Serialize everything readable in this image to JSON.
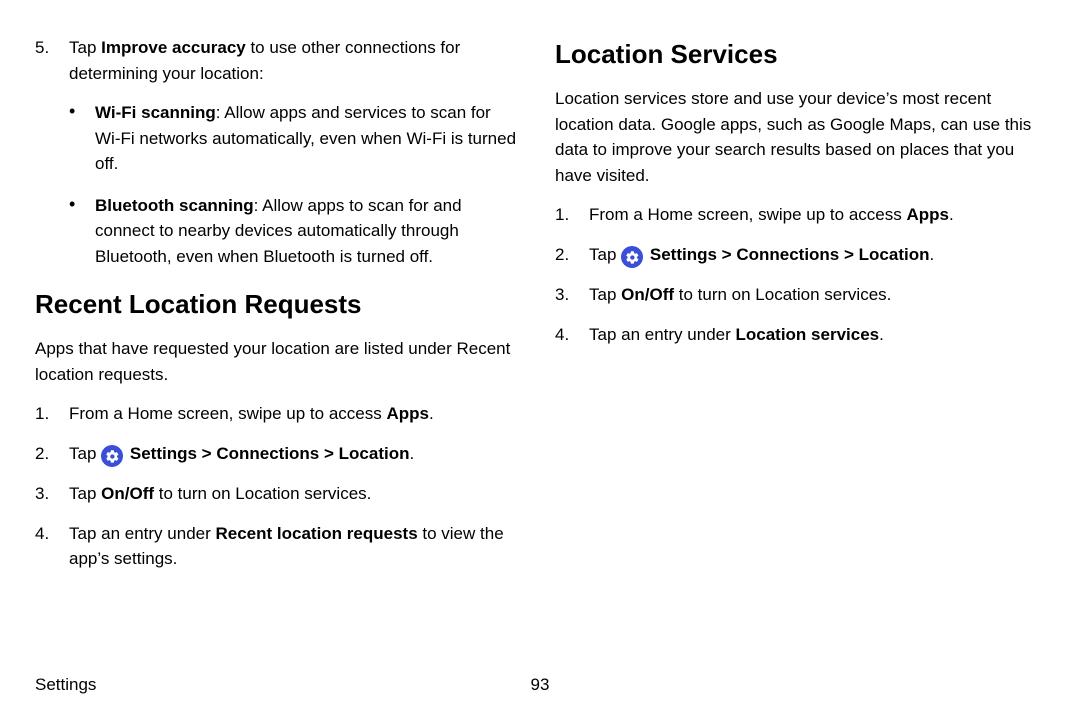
{
  "left": {
    "item5": {
      "num": "5.",
      "pre": "Tap ",
      "bold": "Improve accuracy",
      "post": " to use other connections for determining your location:"
    },
    "wifi": {
      "bold": "Wi‑Fi scanning",
      "post": ": Allow apps and services to scan for Wi‑Fi networks automatically, even when Wi‑Fi is turned off."
    },
    "bt": {
      "bold": "Bluetooth scanning",
      "post": ": Allow apps to scan for and connect to nearby devices automatically through Bluetooth, even when Bluetooth is turned off."
    },
    "h2": "Recent Location Requests",
    "para": "Apps that have requested your location are listed under Recent location requests.",
    "s1": {
      "num": "1.",
      "pre": "From a Home screen, swipe up to access ",
      "bold": "Apps",
      "post": "."
    },
    "s2": {
      "num": "2.",
      "pre": "Tap ",
      "b1": "Settings",
      "sep": " > ",
      "b2": "Connections",
      "b3": "Location",
      "post": "."
    },
    "s3": {
      "num": "3.",
      "pre": "Tap ",
      "bold": "On/Off",
      "post": " to turn on Location services."
    },
    "s4": {
      "num": "4.",
      "pre": "Tap an entry under ",
      "bold": "Recent location requests",
      "post": " to view the app’s settings."
    }
  },
  "right": {
    "h2": "Location Services",
    "para": "Location services store and use your device’s most recent location data. Google apps, such as Google Maps, can use this data to improve your search results based on places that you have visited.",
    "s1": {
      "num": "1.",
      "pre": "From a Home screen, swipe up to access ",
      "bold": "Apps",
      "post": "."
    },
    "s2": {
      "num": "2.",
      "pre": "Tap ",
      "b1": "Settings",
      "sep": " > ",
      "b2": "Connections",
      "b3": "Location",
      "post": "."
    },
    "s3": {
      "num": "3.",
      "pre": "Tap ",
      "bold": "On/Off",
      "post": " to turn on Location services."
    },
    "s4": {
      "num": "4.",
      "pre": "Tap an entry under ",
      "bold": "Location services",
      "post": "."
    }
  },
  "footer": {
    "section": "Settings",
    "page": "93"
  }
}
